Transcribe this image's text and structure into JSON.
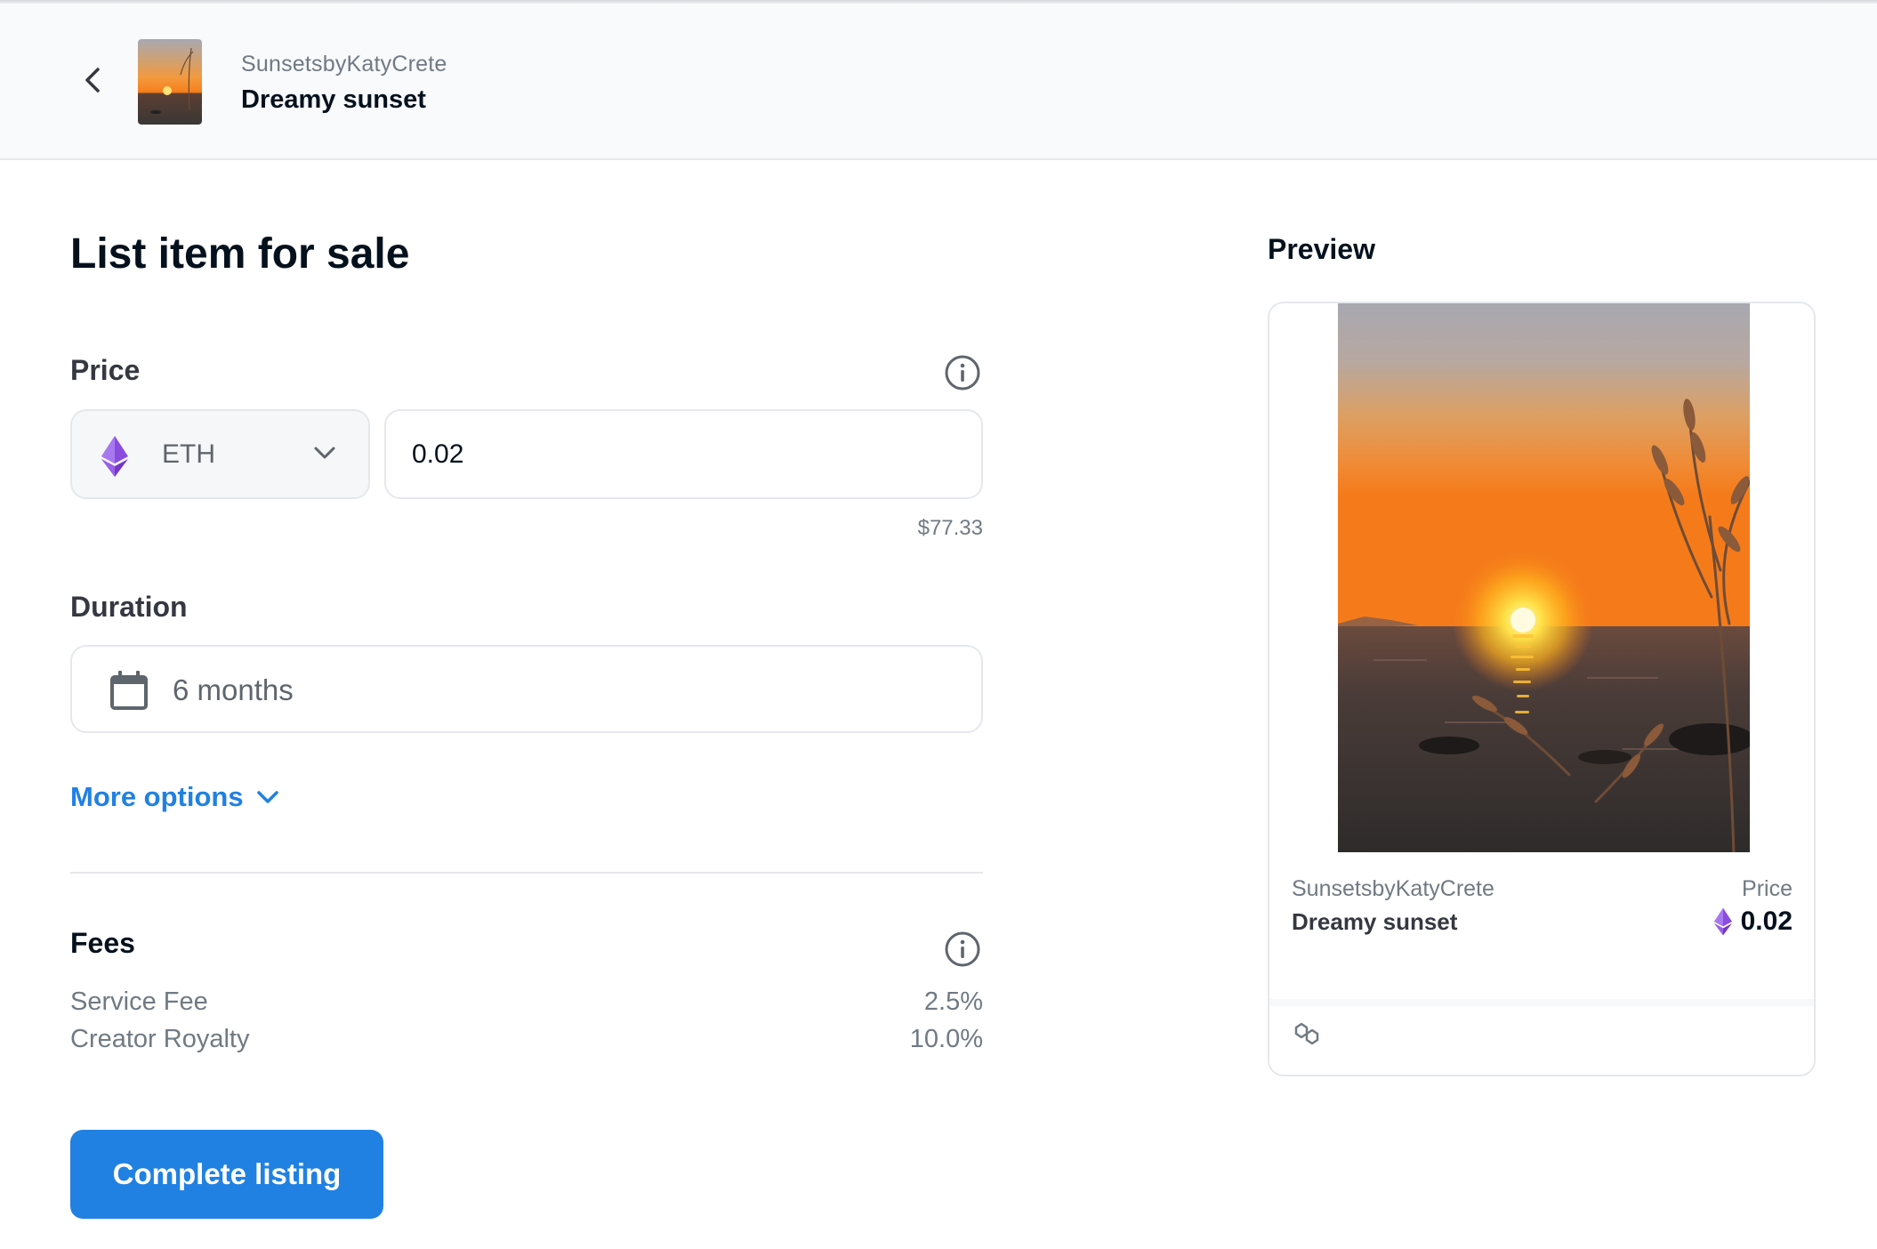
{
  "header": {
    "collection": "SunsetsbyKatyCrete",
    "title": "Dreamy sunset"
  },
  "form": {
    "page_title": "List item for sale",
    "price_label": "Price",
    "currency": "ETH",
    "price_value": "0.02",
    "usd_value": "$77.33",
    "duration_label": "Duration",
    "duration_value": "6 months",
    "more_options": "More options",
    "fees_label": "Fees",
    "fees": [
      {
        "name": "Service Fee",
        "value": "2.5%"
      },
      {
        "name": "Creator Royalty",
        "value": "10.0%"
      }
    ],
    "submit_label": "Complete listing"
  },
  "preview": {
    "label": "Preview",
    "collection": "SunsetsbyKatyCrete",
    "title": "Dreamy sunset",
    "price_label": "Price",
    "price": "0.02"
  },
  "icons": {
    "back": "chevron-left-icon",
    "currency": "ethereum-icon",
    "dropdown": "chevron-down-icon",
    "info": "info-icon",
    "calendar": "calendar-icon",
    "chain": "polygon-icon"
  },
  "colors": {
    "accent": "#2081e2",
    "ethereum": "#8a4cdf",
    "text_primary": "#04111d",
    "text_secondary": "#707a83",
    "border": "#e5e8eb"
  }
}
